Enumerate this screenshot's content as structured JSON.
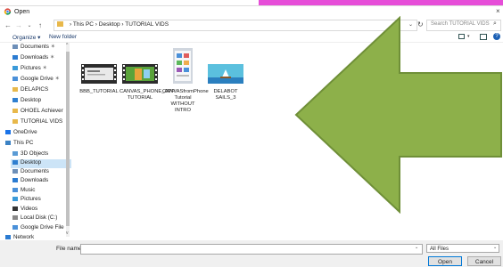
{
  "window": {
    "title": "Open"
  },
  "address": {
    "path": [
      "This PC",
      "Desktop",
      "TUTORIAL VIDS"
    ],
    "search_placeholder": "Search TUTORIAL VIDS"
  },
  "toolbar": {
    "organize": "Organize ▾",
    "new_folder": "New folder"
  },
  "sidebar": {
    "items": [
      {
        "label": "Documents",
        "icon": "documents-icon",
        "pinned": true
      },
      {
        "label": "Downloads",
        "icon": "download-icon",
        "pinned": true
      },
      {
        "label": "Pictures",
        "icon": "pictures-icon",
        "pinned": true
      },
      {
        "label": "Google Drive",
        "icon": "drive-icon",
        "pinned": true
      },
      {
        "label": "DELAPICS",
        "icon": "folder-icon"
      },
      {
        "label": "Desktop",
        "icon": "desktop-icon"
      },
      {
        "label": "OHOEL Achiever",
        "icon": "folder-icon"
      },
      {
        "label": "TUTORIAL VIDS",
        "icon": "folder-icon"
      },
      {
        "label": "OneDrive",
        "icon": "cloud-icon"
      },
      {
        "label": "This PC",
        "icon": "pc-icon"
      },
      {
        "label": "3D Objects",
        "icon": "3d-icon"
      },
      {
        "label": "Desktop",
        "icon": "desktop-icon",
        "selected": true
      },
      {
        "label": "Documents",
        "icon": "documents-icon"
      },
      {
        "label": "Downloads",
        "icon": "download-icon"
      },
      {
        "label": "Music",
        "icon": "music-icon"
      },
      {
        "label": "Pictures",
        "icon": "pictures-icon"
      },
      {
        "label": "Videos",
        "icon": "videos-icon"
      },
      {
        "label": "Local Disk (C:)",
        "icon": "disk-icon"
      },
      {
        "label": "Google Drive File",
        "icon": "drive-icon"
      },
      {
        "label": "Network",
        "icon": "network-icon"
      }
    ]
  },
  "files": [
    {
      "name": "BBB_TUTORIAL",
      "kind": "video"
    },
    {
      "name": "CANVAS_PHONE_APP TUTORIAL",
      "kind": "video"
    },
    {
      "name": "CANVASfromPhone Tutorial WITHOUT INTRO",
      "kind": "phone"
    },
    {
      "name": "DELABOT SAILS_3",
      "kind": "image"
    }
  ],
  "bottom": {
    "file_name_label": "File name:",
    "file_name_value": "",
    "filter": "All Files",
    "open": "Open",
    "cancel": "Cancel"
  },
  "colors": {
    "arrow": "#8db04a",
    "arrow_border": "#6f8f38",
    "accent": "#0078d7",
    "magenta": "#e64dd8"
  }
}
